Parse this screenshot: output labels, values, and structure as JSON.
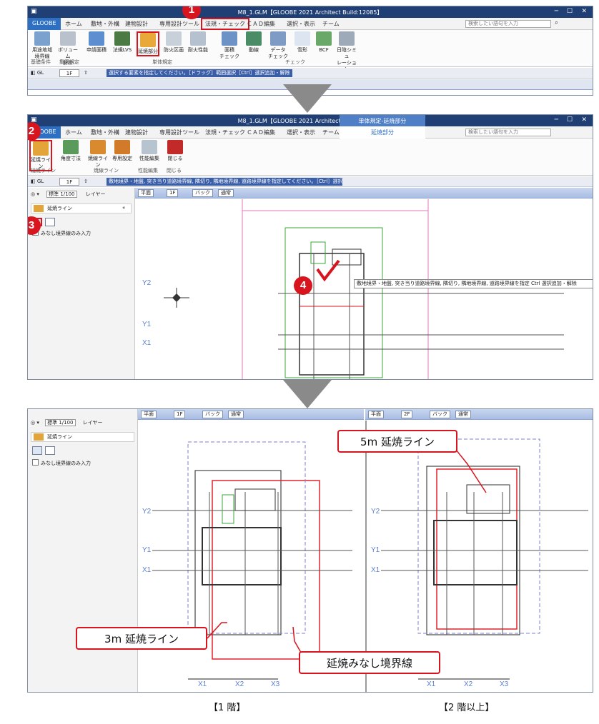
{
  "window1": {
    "title": "M8_1.GLM【GLOOBE 2021 Architect Build:12085】",
    "tabs": [
      "GLOOBE",
      "ホーム",
      "敷地・外構",
      "建物設計",
      "専用設計ツール",
      "法規・チェック",
      "ＣＡＤ編集",
      "選択・表示",
      "チーム"
    ],
    "search_placeholder": "検索したい語句を入力",
    "ribbon_buttons": [
      "用途地域\n境界線",
      "ボリューム\n解析",
      "申請面積",
      "法規LVS",
      "延焼部分",
      "防火区画",
      "耐火性能",
      "面積\nチェック",
      "動線",
      "データ\nチェック",
      "雪形",
      "BCF",
      "日陰シミュ\nレーション"
    ],
    "groups": [
      "基礎条件",
      "集団規定",
      "単体規定",
      "チェック"
    ],
    "toolbar_floor": "1F",
    "toolbar_hint": "選択する要素を指定してください。［ドラッグ］範囲選択［Ctrl］選択追加・解除"
  },
  "window2": {
    "title": "M8_1.GLM【GLOOBE 2021 Architect Build:12085】",
    "context_tab_group": "単体規定-延焼部分",
    "tabs": [
      "GLOOBE",
      "ホーム",
      "敷地・外構",
      "建物設計",
      "専用設計ツール",
      "法規・チェック",
      "ＣＡＤ編集",
      "選択・表示",
      "チーム",
      "延焼部分"
    ],
    "ribbon_buttons": [
      "延焼ライン",
      "角度寸法",
      "焼線ライン",
      "専用設定",
      "性能編集",
      "閉じる"
    ],
    "groups": [
      "延焼ライン",
      "焼線ライン",
      "性能編集",
      "閉じる"
    ],
    "toolbar_floor": "1F",
    "toolbar_hint": "敷地境界・地盤, 突き当り道路境界線, 隣切り, 隣地境界線, 道路境界線を指定してください。［Ctrl］選択追加",
    "view_bar": {
      "view": "平面",
      "floor": "1F",
      "back": "バック",
      "mode": "通常"
    },
    "scale": "標準 1/100",
    "layer": "レイヤー",
    "panel_title": "延焼ライン",
    "checkbox_label": "みなし境界線のみ入力",
    "tooltip": "敷地境界・地盤, 突き当り道路境界線, 隣切り, 隣地境界線, 道路境界線を指定  Ctrl  選択追加・解除",
    "grid_labels": [
      "Y2",
      "Y1",
      "X1"
    ]
  },
  "window3": {
    "scale": "標準 1/100",
    "layer": "レイヤー",
    "panel_title": "延焼ライン",
    "checkbox_label": "みなし境界線のみ入力",
    "left_view": {
      "view": "平面",
      "floor": "1F",
      "back": "バック",
      "mode": "通常"
    },
    "right_view": {
      "view": "平面",
      "floor": "2F",
      "back": "バック",
      "mode": "通常"
    },
    "grid_left": [
      "Y2",
      "Y1",
      "X1",
      "X1",
      "X2",
      "X3"
    ],
    "grid_right": [
      "Y2",
      "Y1",
      "X1",
      "X1",
      "X2",
      "X3"
    ]
  },
  "callouts": {
    "five_m": "5m 延焼ライン",
    "three_m": "3m 延焼ライン",
    "boundary": "延焼みなし境界線"
  },
  "steps": [
    "1",
    "2",
    "3",
    "4"
  ],
  "captions": {
    "left": "【1 階】",
    "right": "【2 階以上】"
  },
  "colors": {
    "title_bar": "#1f3f75",
    "active_tab": "#2d6fc2",
    "highlight": "#d8151f",
    "fire_line": "#e0222b",
    "boundary_line": "#7a82c8"
  }
}
